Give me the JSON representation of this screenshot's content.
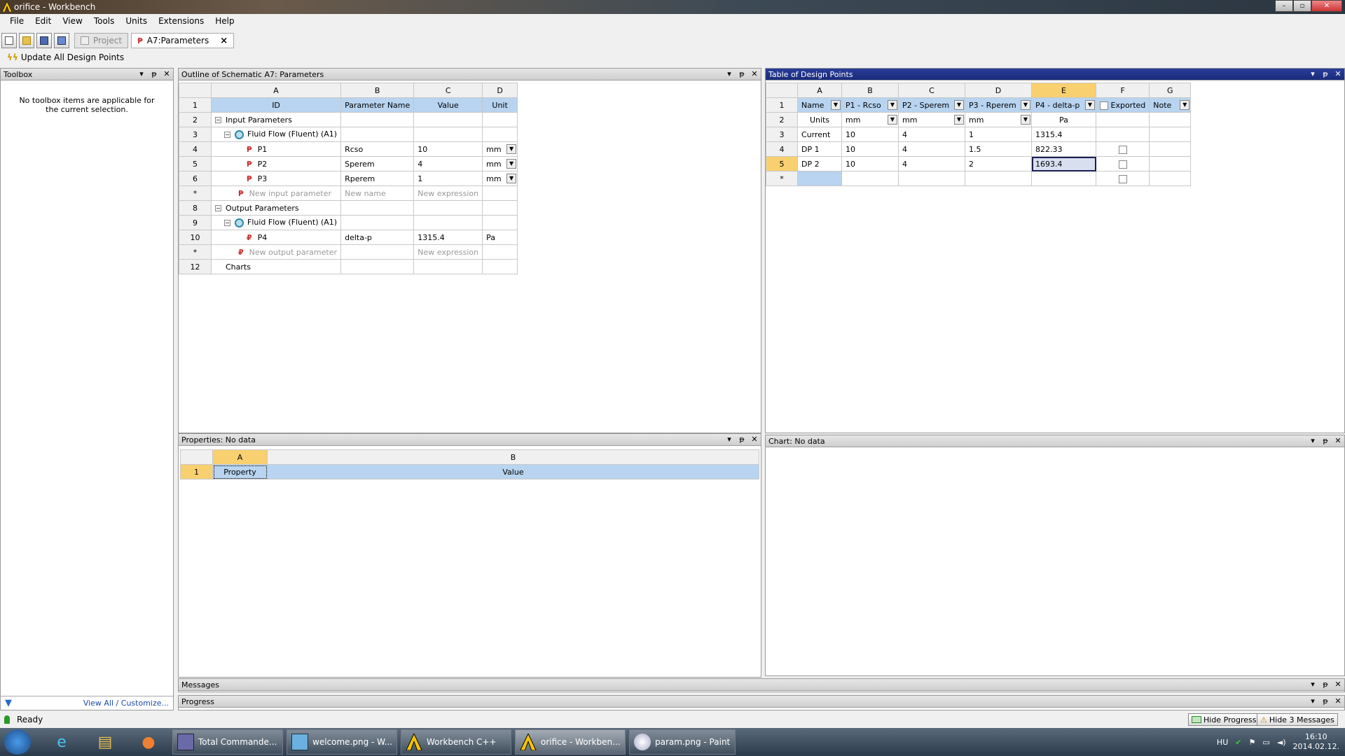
{
  "window": {
    "title": "orifice - Workbench",
    "min": "0",
    "max": "1",
    "close": "r"
  },
  "menu": [
    "File",
    "Edit",
    "View",
    "Tools",
    "Units",
    "Extensions",
    "Help"
  ],
  "tabs": {
    "project": "Project",
    "params": "A7:Parameters",
    "close": "×"
  },
  "toolbar2": {
    "update_label": "Update All Design Points"
  },
  "toolbox": {
    "title": "Toolbox",
    "empty_msg": "No toolbox items are applicable for the current selection.",
    "footer_link": "View All / Customize..."
  },
  "outline": {
    "title": "Outline of Schematic A7: Parameters",
    "col_letters": [
      "A",
      "B",
      "C",
      "D"
    ],
    "headers": [
      "ID",
      "Parameter Name",
      "Value",
      "Unit"
    ],
    "rows": [
      {
        "num": "2",
        "id": "Input Parameters",
        "name": "",
        "value": "",
        "unit": ""
      },
      {
        "num": "3",
        "id": "Fluid Flow (Fluent) (A1)",
        "name": "",
        "value": "",
        "unit": ""
      },
      {
        "num": "4",
        "id": "P1",
        "name": "Rcso",
        "value": "10",
        "unit": "mm"
      },
      {
        "num": "5",
        "id": "P2",
        "name": "Sperem",
        "value": "4",
        "unit": "mm"
      },
      {
        "num": "6",
        "id": "P3",
        "name": "Rperem",
        "value": "1",
        "unit": "mm"
      },
      {
        "num": "*",
        "id": "New input parameter",
        "name": "New name",
        "value": "New expression",
        "unit": ""
      },
      {
        "num": "8",
        "id": "Output Parameters",
        "name": "",
        "value": "",
        "unit": ""
      },
      {
        "num": "9",
        "id": "Fluid Flow (Fluent) (A1)",
        "name": "",
        "value": "",
        "unit": ""
      },
      {
        "num": "10",
        "id": "P4",
        "name": "delta-p",
        "value": "1315.4",
        "unit": "Pa"
      },
      {
        "num": "*",
        "id": "New output parameter",
        "name": "",
        "value": "New expression",
        "unit": ""
      },
      {
        "num": "12",
        "id": "Charts",
        "name": "",
        "value": "",
        "unit": ""
      }
    ]
  },
  "design_points": {
    "title": "Table of Design Points",
    "col_letters": [
      "A",
      "B",
      "C",
      "D",
      "E",
      "F",
      "G"
    ],
    "headers": [
      "Name",
      "P1 - Rcso",
      "P2 - Sperem",
      "P3 - Rperem",
      "P4 - delta-p",
      "Exported",
      "Note"
    ],
    "units": [
      "Units",
      "mm",
      "mm",
      "mm",
      "Pa",
      "",
      ""
    ],
    "rows": [
      {
        "num": "3",
        "name": "Current",
        "p1": "10",
        "p2": "4",
        "p3": "1",
        "p4": "1315.4"
      },
      {
        "num": "4",
        "name": "DP 1",
        "p1": "10",
        "p2": "4",
        "p3": "1.5",
        "p4": "822.33"
      },
      {
        "num": "5",
        "name": "DP 2",
        "p1": "10",
        "p2": "4",
        "p3": "2",
        "p4": "1693.4"
      },
      {
        "num": "*",
        "name": "",
        "p1": "",
        "p2": "",
        "p3": "",
        "p4": ""
      }
    ]
  },
  "properties": {
    "title": "Properties: No data",
    "col_letters": [
      "A",
      "B"
    ],
    "headers": [
      "Property",
      "Value"
    ],
    "row_num": "1"
  },
  "chart": {
    "title": "Chart: No data"
  },
  "messages": {
    "title": "Messages"
  },
  "progress": {
    "title": "Progress"
  },
  "status": {
    "text": "Ready",
    "hide_progress": "Hide Progress",
    "hide_messages": "Hide 3 Messages"
  },
  "taskbar": {
    "tasks": [
      "Total Commande...",
      "welcome.png - W...",
      "Workbench C++",
      "orifice - Workben...",
      "param.png - Paint"
    ],
    "lang": "HU",
    "time": "16:10",
    "date": "2014.02.12."
  },
  "colors": {
    "accent_blue": "#1a2b7a",
    "highlight": "#f8d070",
    "header_blue": "#b8d4f0"
  }
}
